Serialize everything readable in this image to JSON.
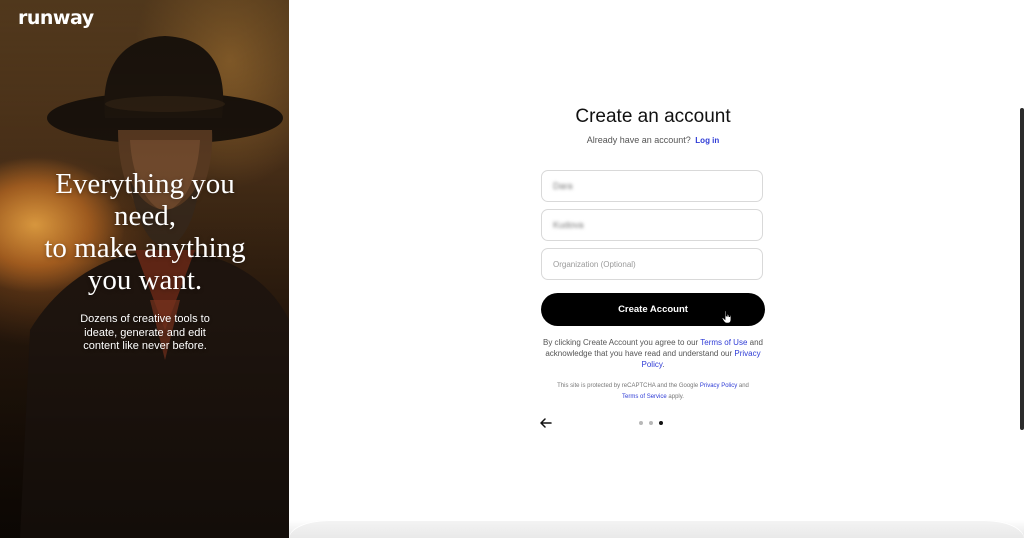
{
  "brand": {
    "logo": "runway"
  },
  "hero": {
    "headline": "Everything you\nneed,\nto make anything\nyou want.",
    "subtext": "Dozens of creative tools to ideate, generate and edit content like never before."
  },
  "form": {
    "title": "Create an account",
    "already_text": "Already have an account?",
    "login_link": "Log in",
    "fields": [
      {
        "value": "Dara",
        "placeholder": ""
      },
      {
        "value": "Kudova",
        "placeholder": ""
      },
      {
        "value": "",
        "placeholder": "Organization (Optional)"
      }
    ],
    "submit_label": "Create Account",
    "terms": {
      "prefix": "By clicking Create Account you agree to our",
      "terms_link": "Terms of Use",
      "middle": "and acknowledge that you have read and understand our",
      "privacy_link": "Privacy Policy",
      "suffix": "."
    },
    "recaptcha": {
      "prefix": "This site is protected by reCAPTCHA and the Google",
      "privacy_link": "Privacy Policy",
      "middle": "and",
      "terms_link": "Terms of Service",
      "suffix": "apply."
    },
    "pagination": {
      "total_steps": 3,
      "current_step": 3
    }
  },
  "icons": {
    "back": "arrow-left-icon",
    "cursor": "hand-pointer-icon"
  },
  "colors": {
    "link": "#2e3bd6",
    "button_bg": "#000000",
    "button_text": "#ffffff"
  }
}
